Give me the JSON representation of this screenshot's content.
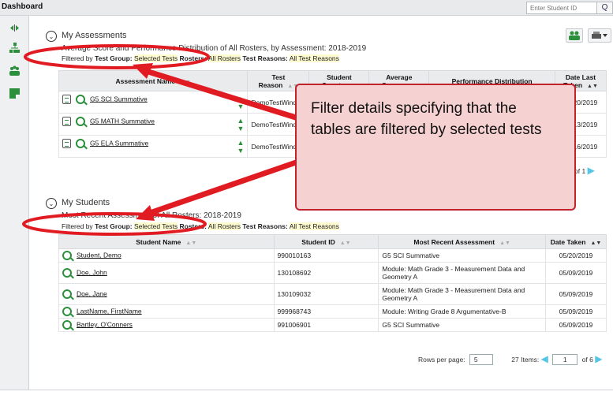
{
  "topbar": {
    "title": "Dashboard",
    "search_placeholder": "Enter Student ID",
    "search_glyph": "Q"
  },
  "assessments": {
    "title": "My Assessments",
    "subtitle": "Average Score and Performance Distribution of All Rosters, by Assessment: 2018-2019",
    "filter_prefix": "Filtered by",
    "filter_group_label": "Test Group:",
    "filter_group_value": "Selected Tests",
    "filter_rosters_label": "Rosters:",
    "filter_rosters_value": "All Rosters",
    "filter_reasons_label": "Test Reasons:",
    "filter_reasons_value": "All Test Reasons",
    "columns": [
      "Assessment Name",
      "Test Reason",
      "Student Count",
      "Average Score",
      "Performance Distribution",
      "Date Last Taken"
    ],
    "rows": [
      {
        "name": "G5 SCI Summative",
        "reason": "DemoTestWindow",
        "date": "05/20/2019"
      },
      {
        "name": "G5 MATH Summative",
        "reason": "DemoTestWindow",
        "date": "05/13/2019"
      },
      {
        "name": "G5 ELA Summative",
        "reason": "DemoTestWindow",
        "date": "05/16/2019"
      }
    ],
    "pager": "of 1"
  },
  "students": {
    "title": "My Students",
    "subtitle": "Most Recent Assessment of All Rosters: 2018-2019",
    "filter_prefix": "Filtered by",
    "filter_group_label": "Test Group:",
    "filter_group_value": "Selected Tests",
    "filter_rosters_label": "Rosters:",
    "filter_rosters_value": "All Rosters",
    "filter_reasons_label": "Test Reasons:",
    "filter_reasons_value": "All Test Reasons",
    "columns": [
      "Student Name",
      "Student ID",
      "Most Recent Assessment",
      "Date Taken"
    ],
    "rows": [
      {
        "name": "Student, Demo",
        "id": "990010163",
        "assessment": "G5 SCI Summative",
        "date": "05/20/2019"
      },
      {
        "name": "Doe, John",
        "id": "130108692",
        "assessment": "Module: Math Grade 3 - Measurement Data and Geometry A",
        "date": "05/09/2019"
      },
      {
        "name": "Doe, Jane",
        "id": "130109032",
        "assessment": "Module: Math Grade 3 - Measurement Data and Geometry A",
        "date": "05/09/2019"
      },
      {
        "name": "LastName, FirstName",
        "id": "999968743",
        "assessment": "Module: Writing Grade 8 Argumentative-B",
        "date": "05/09/2019"
      },
      {
        "name": "Bartley, O'Conners",
        "id": "991006901",
        "assessment": "G5 SCI Summative",
        "date": "05/09/2019"
      }
    ],
    "rows_per_page_label": "Rows per page:",
    "rows_per_page_value": "5",
    "items_label": "27 Items:",
    "page_value": "1",
    "page_of": "of 6"
  },
  "callout": {
    "text": "Filter details specifying that the tables are filtered by selected tests"
  },
  "colors": {
    "accent_red": "#e11b22",
    "callout_fill": "#f6d1d1",
    "green_icon": "#2c8f3c",
    "arrow_blue": "#55c6e6"
  }
}
